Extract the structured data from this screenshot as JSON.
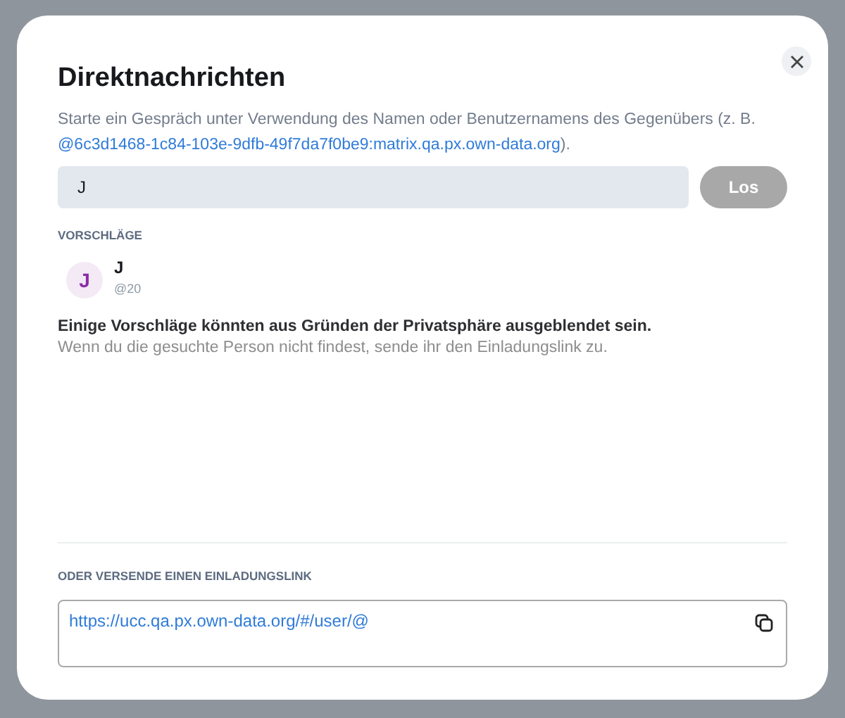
{
  "dialog": {
    "title": "Direktnachrichten",
    "description": {
      "text": "Starte ein Gespräch unter Verwendung des Namen oder Benutzernamens des Gegenübers (z. B.",
      "link": "@6c3d1468-1c84-103e-9dfb-49f7da7f0be9:matrix.qa.px.own-data.org",
      "suffix": ")."
    }
  },
  "search": {
    "value": "J"
  },
  "go_button": {
    "label": "Los",
    "disabled": true
  },
  "suggestions": {
    "heading": "VORSCHLÄGE",
    "items": [
      {
        "initial": "J",
        "name": "J",
        "handle": "@20",
        "color": "#8b2da5"
      }
    ]
  },
  "notice": {
    "title": "Einige Vorschläge könnten aus Gründen der Privatsphäre ausgeblendet sein.",
    "text": "Wenn du die gesuchte Person nicht findest, sende ihr den Einladungslink zu."
  },
  "invite": {
    "heading": "ODER VERSENDE EINEN EINLADUNGSLINK",
    "link": "https://ucc.qa.px.own-data.org/#/user/@"
  }
}
